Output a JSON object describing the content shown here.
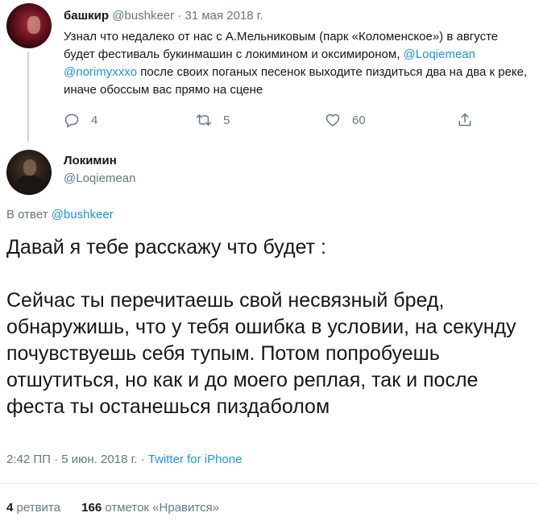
{
  "parent_tweet": {
    "name": "башкир",
    "handle": "@bushkeer",
    "separator": "·",
    "date": "31 мая 2018 г.",
    "text_1": "Узнал что недалеко от нас с А.Мельниковым (парк «Коломенское») в августе будет фестиваль букинмашин с локимином и оксимироном, ",
    "mention_1": "@Loqiemean",
    "mention_2": "@norimyxxxo",
    "text_2": " после своих поганых песенок выходите пиздиться два на два к реке, иначе обоссым вас прямо на сцене",
    "actions": {
      "reply_icon": "reply-icon",
      "reply_count": "4",
      "retweet_icon": "retweet-icon",
      "retweet_count": "5",
      "like_icon": "heart-icon",
      "like_count": "60",
      "share_icon": "share-icon"
    }
  },
  "main_tweet": {
    "name": "Локимин",
    "handle": "@Loqiemean",
    "reply_prefix": "В ответ",
    "reply_mention": "@bushkeer",
    "paragraph_1": "Давай я тебе расскажу что будет :",
    "paragraph_2": "Сейчас ты перечитаешь свой несвязный бред, обнаружишь, что у тебя ошибка в условии, на секунду почувствуешь себя тупым. Потом попробуешь отшутиться, но как и до моего реплая, так и после феста ты останешься пиздаболом",
    "time": "2:42 ПП",
    "date": "5 июн. 2018 г.",
    "separator": "·",
    "source": "Twitter for iPhone",
    "retweets_count": "4",
    "retweets_label": "ретвита",
    "likes_count": "166",
    "likes_label": "отметок «Нравится»"
  },
  "colors": {
    "link": "#1b95e0",
    "secondary": "#657786",
    "primary_text": "#14171a",
    "thread_line": "#ccd6dd"
  }
}
